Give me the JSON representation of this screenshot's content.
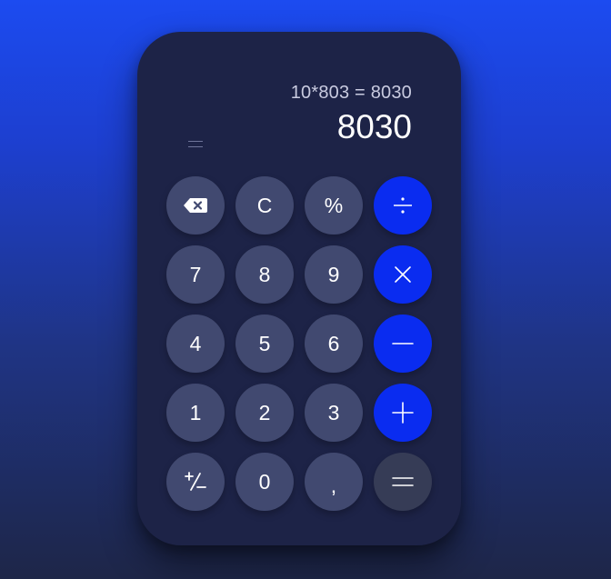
{
  "display": {
    "expression": "10*803 = 8030",
    "result": "8030"
  },
  "keys": {
    "backspace": "backspace-icon",
    "clear": "C",
    "percent": "%",
    "divide": "÷",
    "seven": "7",
    "eight": "8",
    "nine": "9",
    "multiply": "×",
    "four": "4",
    "five": "5",
    "six": "6",
    "subtract": "−",
    "one": "1",
    "two": "2",
    "three": "3",
    "add": "+",
    "plus_minus": "+/−",
    "zero": "0",
    "decimal": ",",
    "equals": "="
  },
  "colors": {
    "background_top": "#1c4bf0",
    "background_bottom": "#1e2648",
    "calculator_body": "#1d2347",
    "digit_key": "#414970",
    "operator_key": "#0a2cf0",
    "equals_key": "#363c56"
  }
}
